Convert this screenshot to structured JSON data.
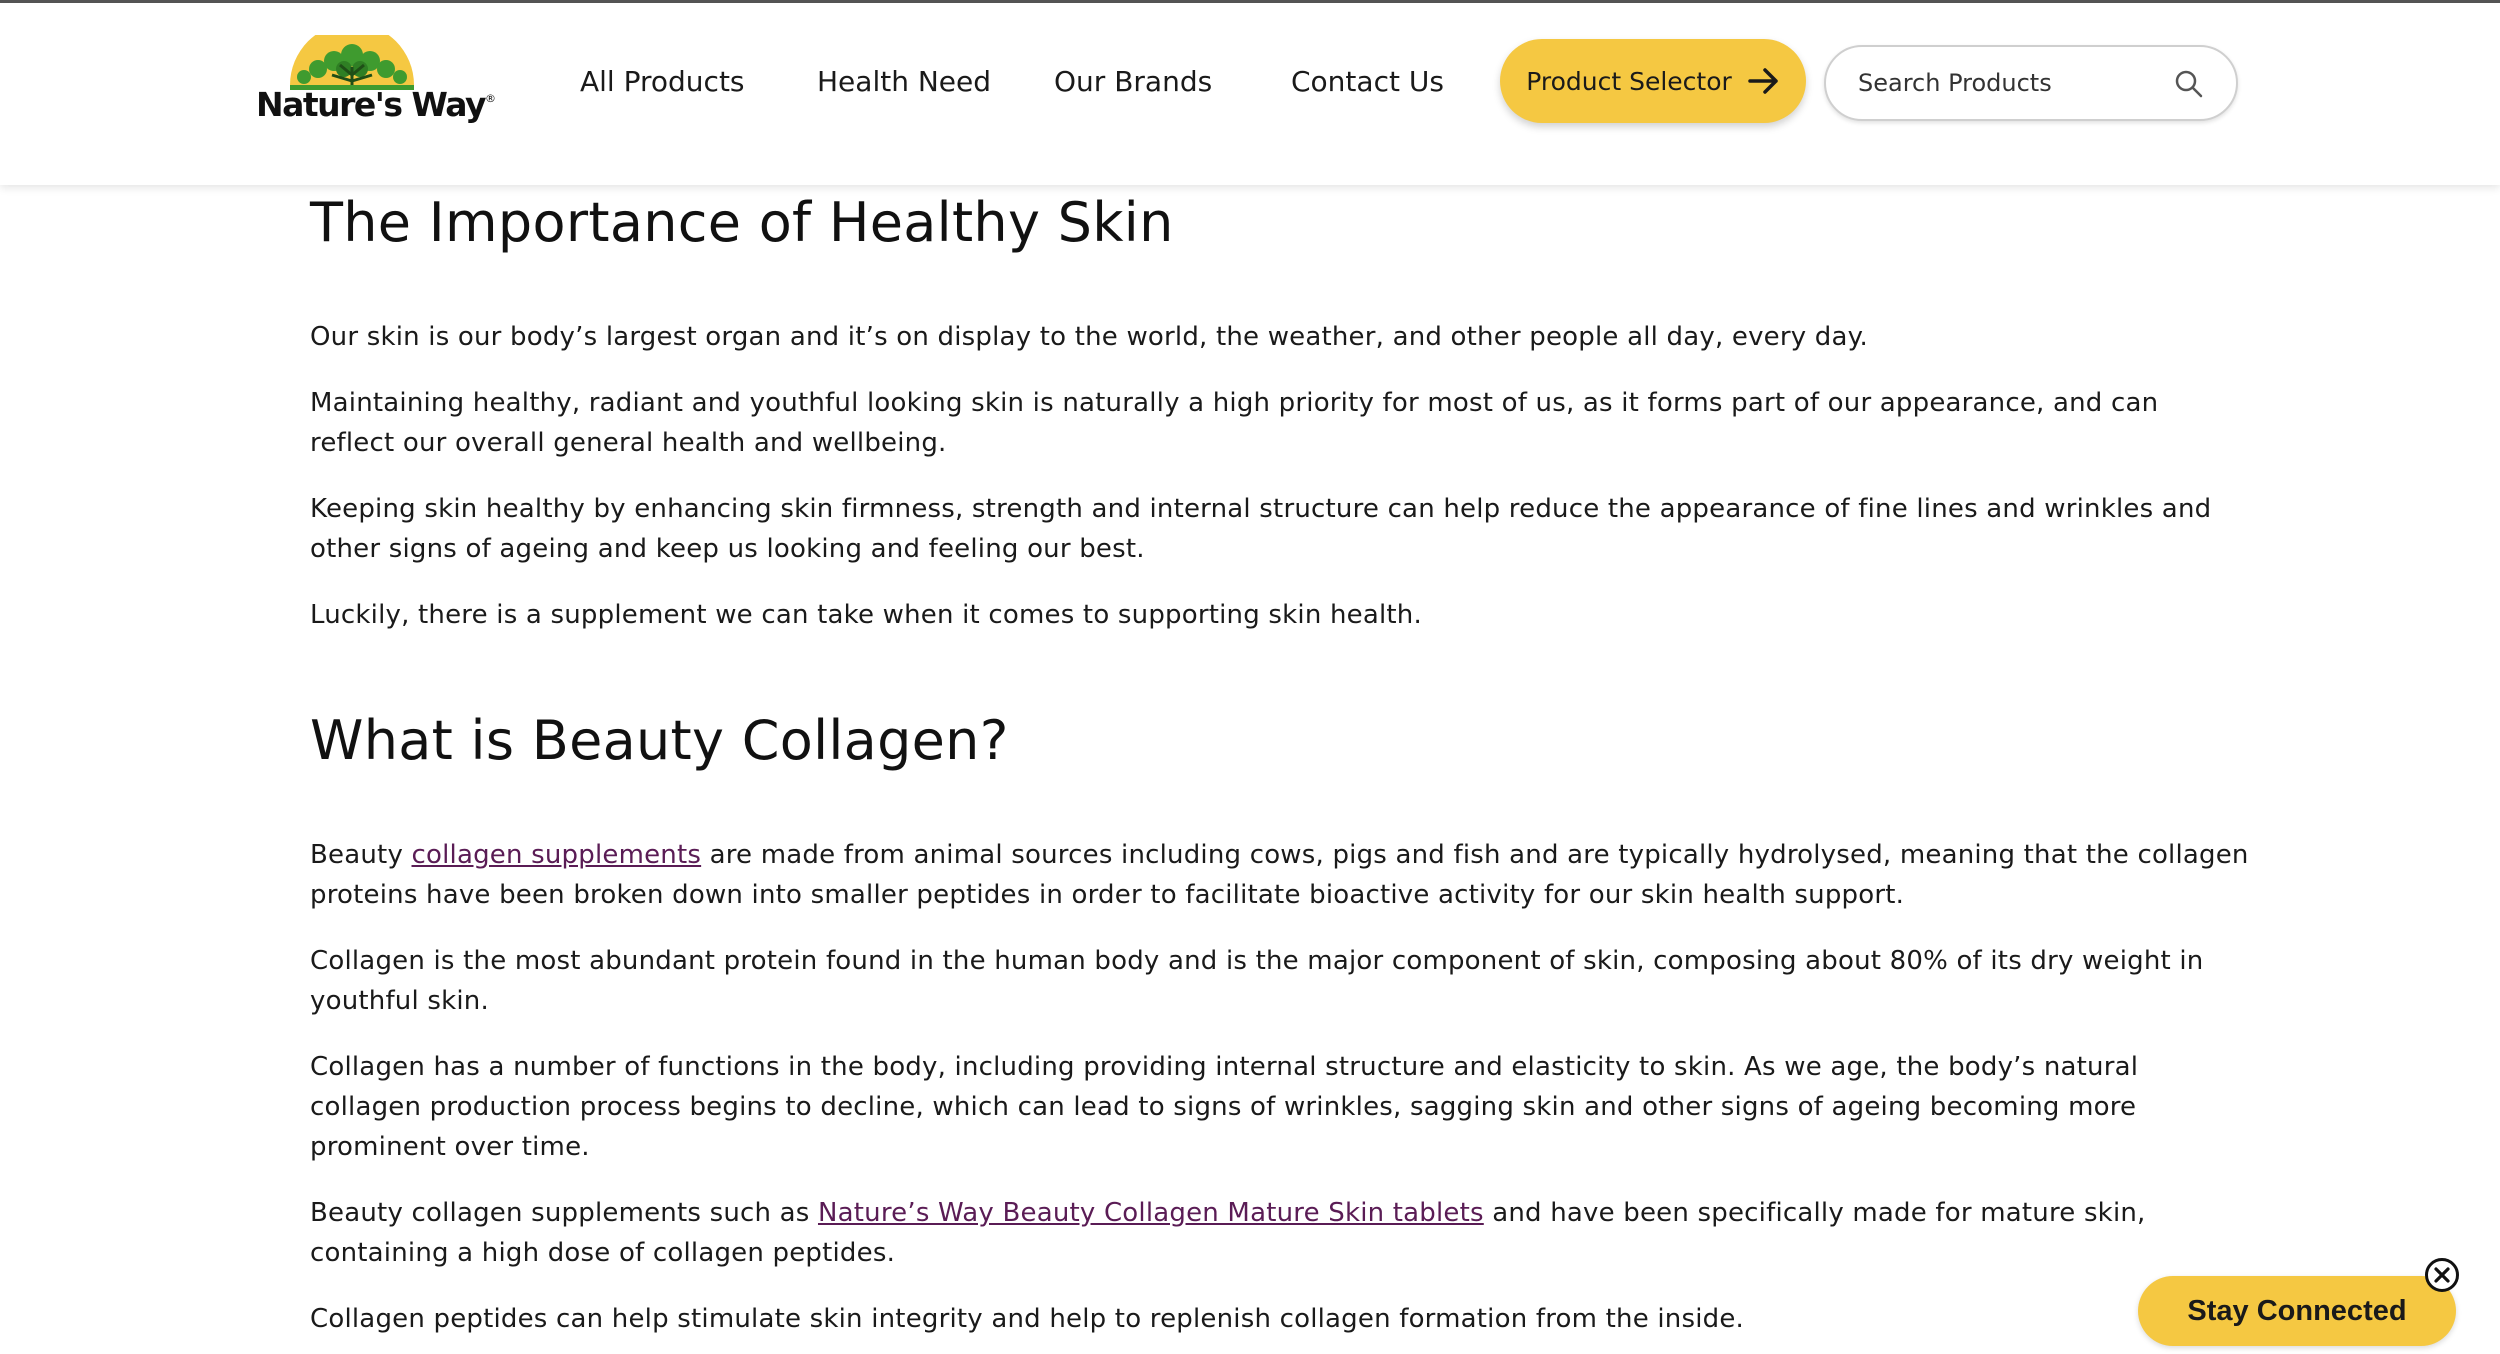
{
  "header": {
    "logo_text": "Nature's Way",
    "logo_mark": "®",
    "nav": [
      {
        "label": "All Products"
      },
      {
        "label": "Health Need"
      },
      {
        "label": "Our Brands"
      },
      {
        "label": "Contact Us"
      }
    ],
    "product_selector_label": "Product Selector",
    "search_placeholder": "Search Products"
  },
  "article": {
    "section1": {
      "heading": "The Importance of Healthy Skin",
      "paragraphs": [
        "Our skin is our body’s largest organ and it’s on display to the world, the weather, and other people all day, every day.",
        "Maintaining healthy, radiant and youthful looking skin is naturally a high priority for most of us, as it forms part of our appearance, and can reflect our overall general health and wellbeing.",
        "Keeping skin healthy by enhancing skin firmness, strength and internal structure can help reduce the appearance of fine lines and wrinkles and other signs of ageing and keep us looking and feeling our best.",
        "Luckily, there is a supplement we can take when it comes to supporting skin health."
      ]
    },
    "section2": {
      "heading": "What is Beauty Collagen?",
      "p1_before": "Beauty ",
      "p1_link": "collagen supplements",
      "p1_after": " are made from animal sources including cows, pigs and fish and are typically hydrolysed, meaning that the collagen proteins have been broken down into smaller peptides in order to facilitate bioactive activity for our skin health support.",
      "p2": "Collagen is the most abundant protein found in the human body and is the major component of skin, composing about 80% of its dry weight in youthful skin.",
      "p3": "Collagen has a number of functions in the body, including providing internal structure and elasticity to skin. As we age, the body’s natural collagen production process begins to decline, which can lead to signs of wrinkles, sagging skin and other signs of ageing becoming more prominent over time.",
      "p4_before": "Beauty collagen supplements such as ",
      "p4_link": "Nature’s Way Beauty Collagen Mature Skin tablets",
      "p4_after": " and have been specifically made for mature skin, containing a high dose of collagen peptides.",
      "p5": "Collagen peptides can help stimulate skin integrity and help to replenish collagen formation from the inside."
    }
  },
  "popup": {
    "stay_connected_label": "Stay Connected"
  },
  "colors": {
    "accent_yellow": "#f5c842",
    "link_purple": "#5a1c55",
    "text": "#1a1a1a"
  },
  "icons": [
    "logo-tree-icon",
    "arrow-right-icon",
    "search-icon",
    "close-circle-icon"
  ]
}
